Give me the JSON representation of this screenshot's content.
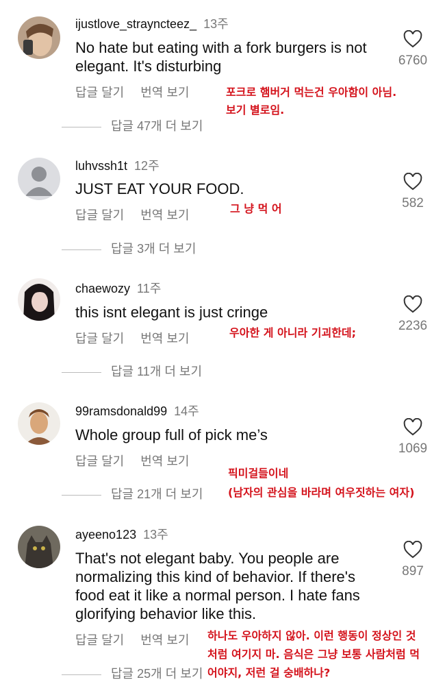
{
  "comments": [
    {
      "username": "ijustlove_strayncteez_",
      "time": "13주",
      "text": "No hate but eating with a fork burgers is not elegant. It's disturbing",
      "reply_label": "답글 달기",
      "translate_label": "번역 보기",
      "likes": "6760",
      "view_replies": "답글 47개 더 보기",
      "annotation": [
        "포크로 햄버거 먹는건 우아함이 아님.",
        "보기 별로임."
      ]
    },
    {
      "username": "luhvssh1t",
      "time": "12주",
      "text": "JUST EAT YOUR FOOD.",
      "reply_label": "답글 달기",
      "translate_label": "번역 보기",
      "likes": "582",
      "view_replies": "답글 3개 더 보기",
      "annotation": [
        "그 냥 먹 어"
      ]
    },
    {
      "username": "chaewozy",
      "time": "11주",
      "text": "this isnt elegant is just cringe",
      "reply_label": "답글 달기",
      "translate_label": "번역 보기",
      "likes": "2236",
      "view_replies": "답글 11개 더 보기",
      "annotation": [
        "우아한 게 아니라 기괴한데;"
      ]
    },
    {
      "username": "99ramsdonald99",
      "time": "14주",
      "text": "Whole group full of pick me’s",
      "reply_label": "답글 달기",
      "translate_label": "번역 보기",
      "likes": "1069",
      "view_replies": "답글 21개 더 보기",
      "annotation": [
        "픽미걸들이네",
        "(남자의 관심을 바라며 여우짓하는 여자)"
      ]
    },
    {
      "username": "ayeeno123",
      "time": "13주",
      "text": "That's not elegant baby. You people are normalizing this kind of behavior. If there's food eat it like a normal person. I hate fans glorifying behavior like this.",
      "reply_label": "답글 달기",
      "translate_label": "번역 보기",
      "likes": "897",
      "view_replies": "답글 25개 더 보기",
      "annotation": [
        "하나도 우아하지 않아. 이런 행동이 정상인 것",
        "처럼 여기지 마. 음식은 그냥 보통 사람처럼 먹",
        "어야지, 저런 걸 숭배하나?"
      ]
    }
  ],
  "colors": {
    "annotation": "#d4121b",
    "muted": "#777777",
    "text": "#111111"
  }
}
